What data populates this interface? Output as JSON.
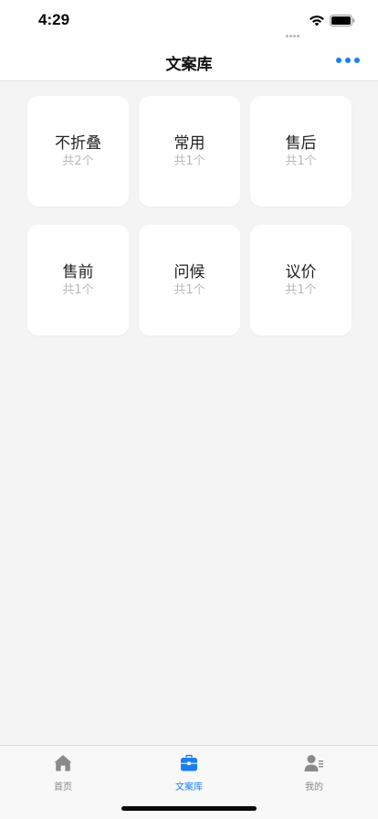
{
  "status_bar": {
    "time": "4:29"
  },
  "nav": {
    "title": "文案库"
  },
  "cards": [
    {
      "title": "不折叠",
      "count": "共2个"
    },
    {
      "title": "常用",
      "count": "共1个"
    },
    {
      "title": "售后",
      "count": "共1个"
    },
    {
      "title": "售前",
      "count": "共1个"
    },
    {
      "title": "问候",
      "count": "共1个"
    },
    {
      "title": "议价",
      "count": "共1个"
    }
  ],
  "tabs": [
    {
      "label": "首页",
      "icon": "home-icon",
      "active": false
    },
    {
      "label": "文案库",
      "icon": "briefcase-icon",
      "active": true
    },
    {
      "label": "我的",
      "icon": "user-profile-icon",
      "active": false
    }
  ],
  "colors": {
    "accent": "#1a7ff2",
    "background": "#f4f4f4",
    "inactive": "#888888"
  }
}
